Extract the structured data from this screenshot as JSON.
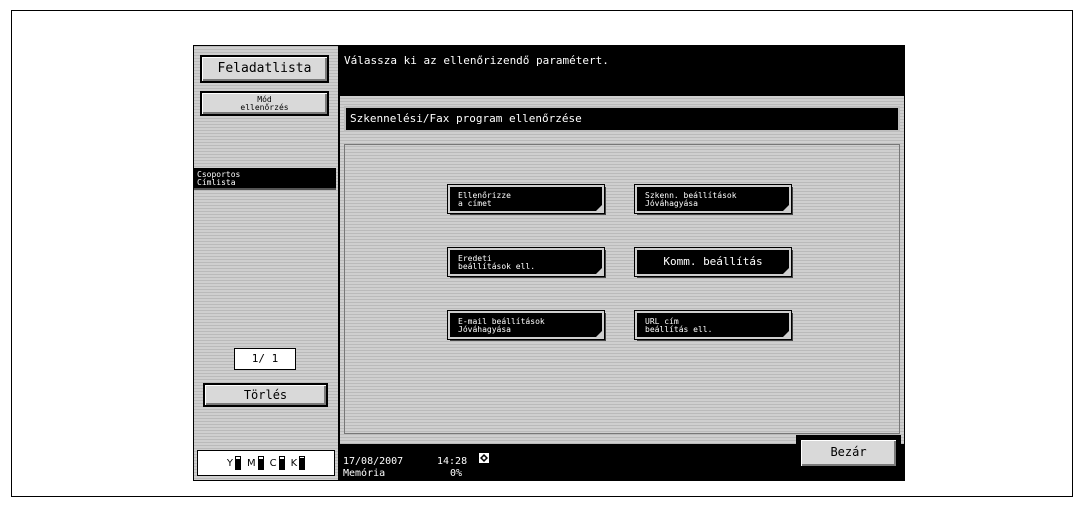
{
  "left_panel": {
    "job_list_label": "Feladatlista",
    "mode_check_label": [
      "Mód",
      "ellenőrzés"
    ],
    "group_label": [
      "Csoportos",
      "Címlista"
    ],
    "page_counter": "1/ 1",
    "delete_label": "Törlés"
  },
  "toner": [
    {
      "color": "Y",
      "level": 0.8
    },
    {
      "color": "M",
      "level": 0.8
    },
    {
      "color": "C",
      "level": 0.8
    },
    {
      "color": "K",
      "level": 0.9
    }
  ],
  "message": "Válassza ki az ellenőrizendő paramétert.",
  "panel_title": "Szkennelési/Fax program ellenőrzése",
  "options": [
    {
      "lines": [
        "Ellenőrizze",
        "a címet"
      ]
    },
    {
      "lines": [
        "Szkenn. beállítások",
        "Jóváhagyása"
      ]
    },
    {
      "lines": [
        "Eredeti",
        "beállítások ell."
      ]
    },
    {
      "lines": [
        "Komm. beállítás"
      ]
    },
    {
      "lines": [
        "E-mail beállítások",
        "Jóváhagyása"
      ]
    },
    {
      "lines": [
        "URL cím",
        "beállítás ell."
      ]
    }
  ],
  "status": {
    "date": "17/08/2007",
    "time": "14:28",
    "memory_label": "Memória",
    "memory_value": "0%"
  },
  "close_label": "Bezár"
}
